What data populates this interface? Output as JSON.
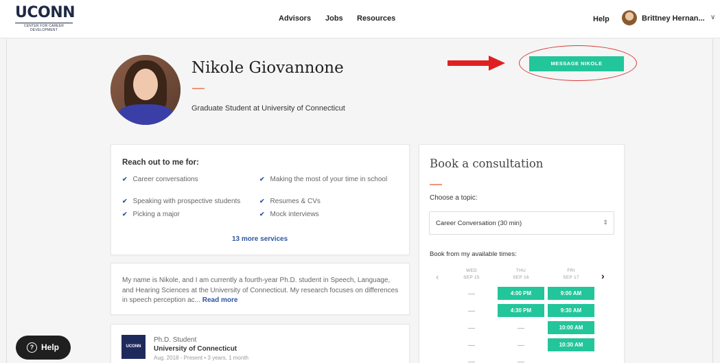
{
  "header": {
    "logo_main": "UCONN",
    "logo_sub": "CENTER FOR CAREER DEVELOPMENT",
    "nav": [
      "Advisors",
      "Jobs",
      "Resources"
    ],
    "help": "Help",
    "user_name": "Brittney Hernan...",
    "chevron": "∨"
  },
  "profile": {
    "name": "Nikole Giovannone",
    "title": "Graduate Student at University of Connecticut",
    "message_button": "MESSAGE NIKOLE"
  },
  "reach": {
    "title": "Reach out to me for:",
    "services": [
      "Career conversations",
      "Making the most of your time in school",
      "Speaking with prospective students",
      "Resumes & CVs",
      "Picking a major",
      "Mock interviews"
    ],
    "more": "13 more services"
  },
  "bio": {
    "text": "My name is Nikole, and I am currently a fourth-year Ph.D. student in Speech, Language, and Hearing Sciences at the University of Connecticut. My research focuses on differences in speech perception ac...",
    "read_more": "Read more"
  },
  "education": {
    "logo": "UCONN",
    "role": "Ph.D. Student",
    "school": "University of Connecticut",
    "dates": "Aug. 2018 - Present • 3 years, 1 month"
  },
  "booking": {
    "title": "Book a consultation",
    "choose_label": "Choose a topic:",
    "topic_value": "Career Conversation (30 min)",
    "book_from": "Book from my available times:",
    "days": [
      {
        "name": "WED",
        "date": "SEP 15"
      },
      {
        "name": "THU",
        "date": "SEP 16"
      },
      {
        "name": "FRI",
        "date": "SEP 17"
      }
    ],
    "thu_slots": [
      "4:00 PM",
      "4:30 PM"
    ],
    "fri_slots": [
      "9:00 AM",
      "9:30 AM",
      "10:00 AM",
      "10:30 AM"
    ],
    "dash": "—"
  },
  "help_button": "Help",
  "colors": {
    "accent_green": "#23c59a",
    "link_blue": "#2e54a0",
    "annotation_red": "#d93a3a",
    "accent_salmon": "#f0947a"
  }
}
